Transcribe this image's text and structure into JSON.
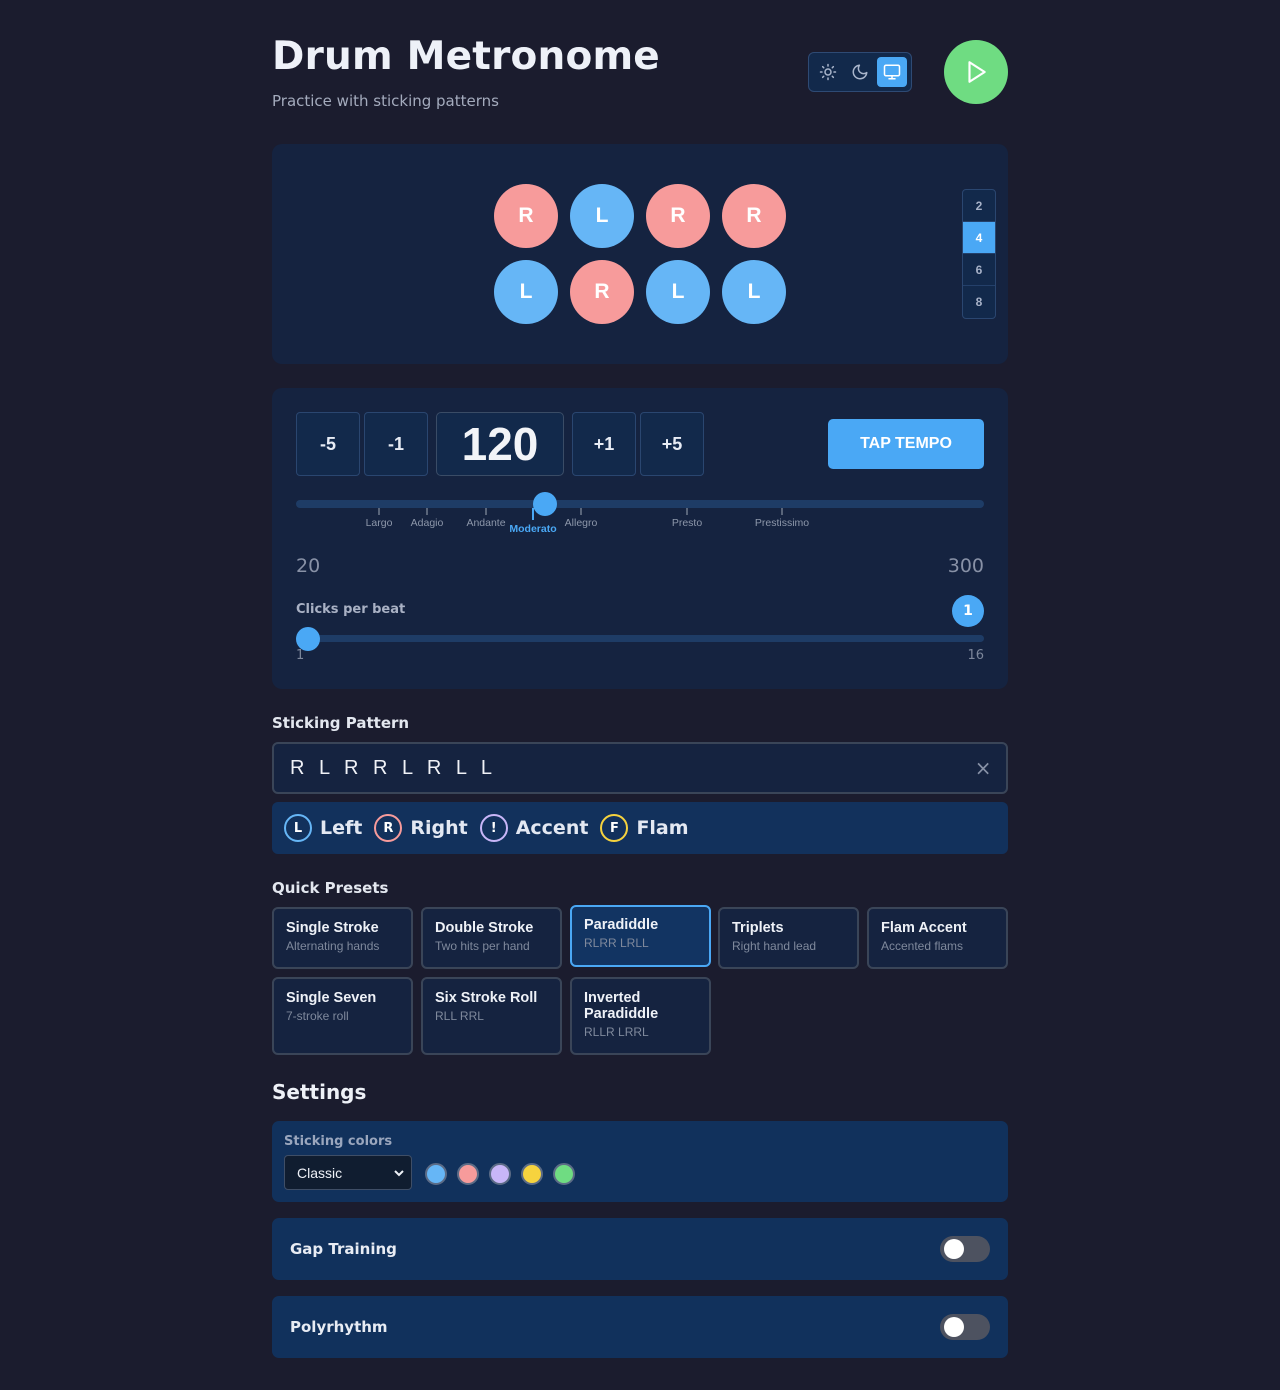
{
  "header": {
    "title": "Drum Metronome",
    "subtitle": "Practice with sticking patterns"
  },
  "theme": {
    "options": [
      "light",
      "dark",
      "system"
    ],
    "selected": "system",
    "icons": [
      "sun-icon",
      "moon-icon",
      "monitor-icon"
    ]
  },
  "playback": {
    "icon": "play-icon"
  },
  "beats": [
    "R",
    "L",
    "R",
    "R",
    "L",
    "R",
    "L",
    "L"
  ],
  "subdivisions": {
    "options": [
      "2",
      "4",
      "6",
      "8"
    ],
    "selected": "4"
  },
  "tempo": {
    "steps": [
      "-5",
      "-1",
      "+1",
      "+5"
    ],
    "bpm": "120",
    "tap_label": "TAP TEMPO",
    "min": "20",
    "max": "300",
    "markings": [
      "Largo",
      "Adagio",
      "Andante",
      "Moderato",
      "Allegro",
      "Presto",
      "Prestissimo"
    ],
    "active_marking": "Moderato"
  },
  "clicks": {
    "label": "Clicks per beat",
    "value": "1",
    "min": "1",
    "max": "16"
  },
  "sticking": {
    "label": "Sticking Pattern",
    "value": "R L R R L R L L",
    "clear": "×"
  },
  "legend": [
    {
      "symbol": "L",
      "text": "Left",
      "color": "#66b6f6"
    },
    {
      "symbol": "R",
      "text": "Right",
      "color": "#f79b9b"
    },
    {
      "symbol": "!",
      "text": "Accent",
      "color": "#c8b6f8"
    },
    {
      "symbol": "F",
      "text": "Flam",
      "color": "#f6d33e"
    }
  ],
  "presets": {
    "label": "Quick Presets",
    "items": [
      {
        "name": "Single Stroke",
        "desc": "Alternating hands"
      },
      {
        "name": "Double Stroke",
        "desc": "Two hits per hand"
      },
      {
        "name": "Paradiddle",
        "desc": "RLRR LRLL"
      },
      {
        "name": "Triplets",
        "desc": "Right hand lead"
      },
      {
        "name": "Flam Accent",
        "desc": "Accented flams"
      },
      {
        "name": "Single Seven",
        "desc": "7-stroke roll"
      },
      {
        "name": "Six Stroke Roll",
        "desc": "RLL RRL"
      },
      {
        "name": "Inverted Paradiddle",
        "desc": "RLLR LRRL"
      }
    ],
    "selected": "Paradiddle"
  },
  "settings": {
    "title": "Settings",
    "colors_label": "Sticking colors",
    "scheme": "Classic",
    "swatches": [
      "#66b6f6",
      "#f79b9b",
      "#c8b6f8",
      "#f6d33e",
      "#6fdc82"
    ],
    "gap_training": {
      "label": "Gap Training",
      "on": false
    },
    "polyrhythm": {
      "label": "Polyrhythm",
      "on": false
    }
  }
}
